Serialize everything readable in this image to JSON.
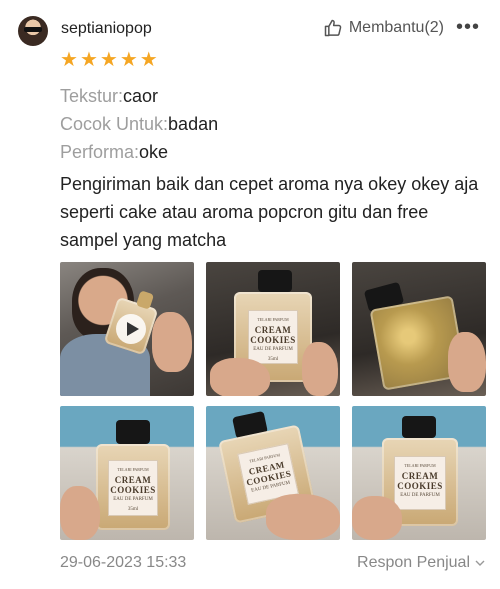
{
  "review": {
    "username": "septianiopop",
    "helpful_label": "Membantu(2)",
    "rating": 5,
    "attributes": [
      {
        "key": "Tekstur:",
        "value": "caor"
      },
      {
        "key": "Cocok Untuk:",
        "value": "badan"
      },
      {
        "key": "Performa:",
        "value": "oke"
      }
    ],
    "text": "Pengiriman baik dan cepet aroma nya okey okey aja seperti cake atau aroma popcron gitu dan free sampel yang matcha",
    "photo_labels": {
      "brand": "TELARI PARFUM",
      "name_line1": "CREAM",
      "name_line2": "COOKIES",
      "subtitle": "EAU DE PARFUM",
      "volume": "35ml"
    },
    "date": "29-06-2023 15:33",
    "seller_reply_label": "Respon Penjual"
  },
  "colors": {
    "star": "#f5a623",
    "muted_text": "#9e9e9e",
    "body_text": "#222222"
  },
  "icons": {
    "helpful": "thumb-up-icon",
    "menu": "more-icon",
    "play": "play-icon",
    "expand": "chevron-down-icon"
  }
}
